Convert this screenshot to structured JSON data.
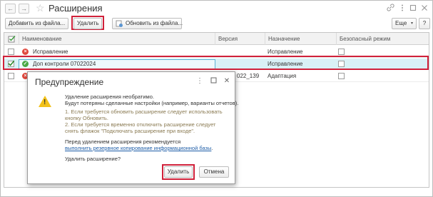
{
  "window": {
    "title": "Расширения",
    "nav_back": "←",
    "nav_forward": "→",
    "star": "☆",
    "icons": [
      "link-icon",
      "more-icon",
      "maximize-icon",
      "close-icon"
    ]
  },
  "toolbar": {
    "add_from_file": "Добавить из файла...",
    "delete": "Удалить",
    "update_from_file": "Обновить из файла...",
    "more": "Еще",
    "help": "?"
  },
  "table": {
    "columns": [
      "Наименование",
      "Версия",
      "Назначение",
      "Безопасный режим"
    ],
    "rows": [
      {
        "name": "Исправление",
        "version": "",
        "purpose": "Исправление",
        "active": false,
        "status": "error"
      },
      {
        "name": "Доп контроли 07022024",
        "version": "",
        "purpose": "Исправление",
        "active": true,
        "status": "ok"
      },
      {
        "name": "",
        "version": "022_139",
        "purpose": "Адаптация",
        "active": false,
        "status": "error"
      }
    ]
  },
  "dialog": {
    "title": "Предупреждение",
    "line1": "Удаление расширения необратимо.",
    "line2": "Будут потеряны сделанные настройки (например, варианты отчетов).",
    "note1a": "1. Если требуется обновить расширение следует использовать",
    "note1b": "кнопку Обновить.",
    "note2a": "2. Если требуется временно отключить расширение следует",
    "note2b": "снять флажок \"Подключать расширение при входе\".",
    "backup_prompt": "Перед удалением расширения рекомендуется",
    "backup_link": "выполнить резервное копирование информационной базы",
    "backup_dot": ".",
    "question": "Удалить расширение?",
    "delete_button": "Удалить",
    "cancel_button": "Отмена"
  },
  "colors": {
    "highlight_frame": "#d0213a",
    "selected_row": "#d9f1f6",
    "warning": "#f2c119",
    "link": "#1f5ea8"
  }
}
